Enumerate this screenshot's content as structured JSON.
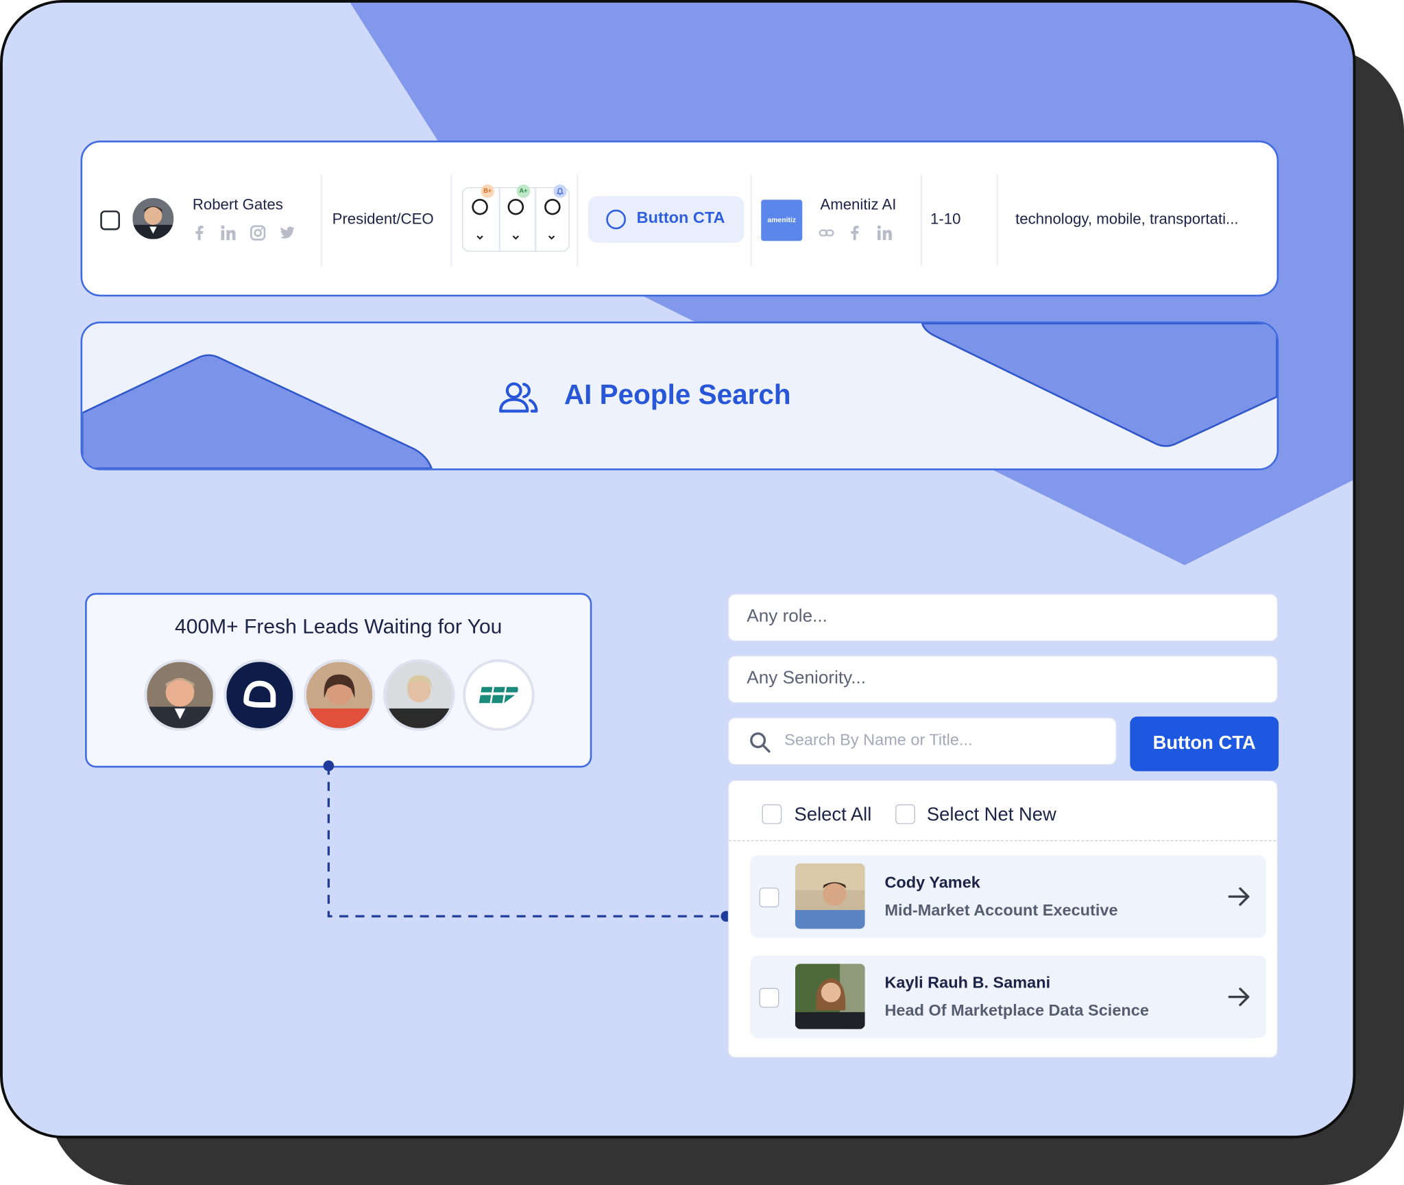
{
  "contact_row": {
    "name": "Robert Gates",
    "title": "President/CEO",
    "score_badges": [
      "B+",
      "A+",
      ""
    ],
    "cta_label": "Button CTA",
    "company_logo_text": "amenitiz",
    "company_name": "Amenitiz AI",
    "employee_range": "1-10",
    "industries": "technology, mobile, transportati...",
    "social_icons": [
      "facebook-icon",
      "linkedin-icon",
      "instagram-icon",
      "twitter-icon"
    ],
    "company_icons": [
      "link-icon",
      "facebook-icon",
      "linkedin-icon"
    ]
  },
  "ai_banner": {
    "title": "AI People Search",
    "icon": "people-icon"
  },
  "leads_card": {
    "title": "400M+ Fresh Leads Waiting for You",
    "avatars": [
      "person-avatar",
      "company-logo-avatar",
      "person-avatar",
      "person-avatar",
      "company-logo-avatar"
    ]
  },
  "search_panel": {
    "role_placeholder": "Any role...",
    "seniority_placeholder": "Any Seniority...",
    "search_placeholder": "Search By Name or Title...",
    "cta_label": "Button CTA",
    "select_all_label": "Select All",
    "select_net_new_label": "Select Net New",
    "results": [
      {
        "name": "Cody Yamek",
        "title": "Mid-Market Account Executive"
      },
      {
        "name": "Kayli Rauh B. Samani",
        "title": "Head Of Marketplace Data Science"
      }
    ]
  },
  "colors": {
    "accent": "#1e58e0",
    "accent_border": "#3f6ae0",
    "background": "#cfdafa",
    "shape": "#7b93e8",
    "shadow": "#333333"
  }
}
